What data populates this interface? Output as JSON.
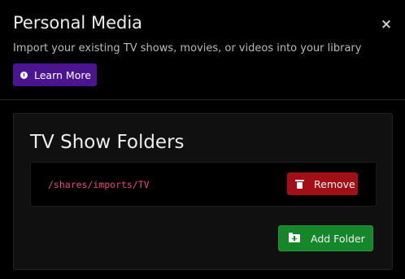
{
  "dialog": {
    "title": "Personal Media",
    "close_glyph": "×",
    "subtitle": "Import your existing TV shows, movies, or videos into your library",
    "learn_more_label": "Learn More",
    "learn_more_icon": "info-circle-icon"
  },
  "section": {
    "title": "TV Show Folders",
    "folders": [
      {
        "path": "/shares/imports/TV",
        "remove_label": "Remove",
        "remove_icon": "trash-icon"
      }
    ],
    "add_folder_label": "Add Folder",
    "add_folder_icon": "folder-plus-icon"
  },
  "colors": {
    "learn_more_bg": "#4b1591",
    "remove_bg": "#a30f16",
    "add_folder_bg": "#16862a",
    "path_text": "#e8467b"
  }
}
